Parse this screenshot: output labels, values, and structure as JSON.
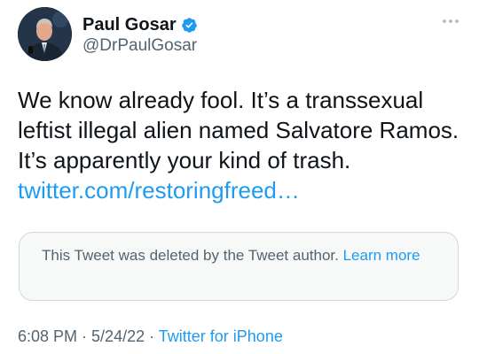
{
  "author": {
    "display_name": "Paul Gosar",
    "handle": "@DrPaulGosar",
    "verified": true
  },
  "tweet": {
    "text_lines": [
      "We know already fool.  It’s a transsexual",
      "leftist illegal alien named Salvatore Ramos.",
      "It’s apparently your kind of trash."
    ],
    "link": "twitter.com/restoringfreed…"
  },
  "quoted": {
    "deleted_text": "This Tweet was deleted by the Tweet author.",
    "learn_more": "Learn more"
  },
  "meta": {
    "time": "6:08 PM",
    "sep1": " · ",
    "date": "5/24/22",
    "sep2": " · ",
    "source": "Twitter for iPhone"
  },
  "colors": {
    "accent": "#1d9bf0",
    "secondary_text": "#536471",
    "card_background": "#f7f9f9"
  },
  "icons": {
    "verified": "verified-badge-icon",
    "more": "more-options-icon"
  }
}
